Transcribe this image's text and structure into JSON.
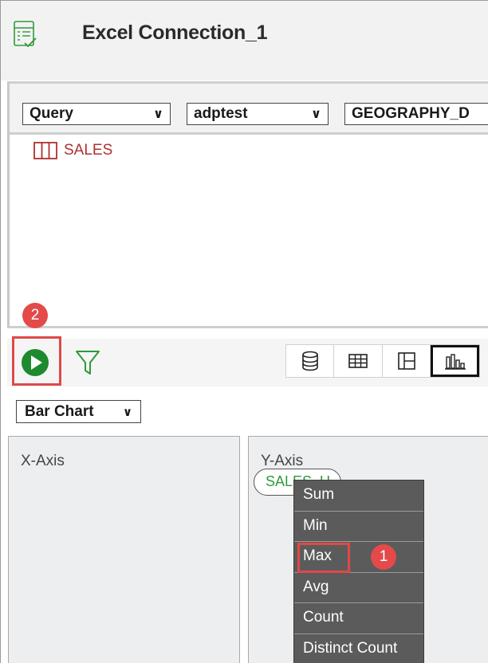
{
  "header": {
    "title": "Excel Connection_1",
    "icon": "excel-connection-icon"
  },
  "query_bar": {
    "query_type": "Query",
    "schema": "adptest",
    "table": "GEOGRAPHY_D"
  },
  "table_list": [
    {
      "label": "SALES",
      "icon": "table-icon"
    }
  ],
  "toolbar": {
    "run_icon": "play-icon",
    "filter_icon": "filter-icon",
    "views": [
      "database-icon",
      "table-view-icon",
      "layout-icon",
      "bar-chart-icon"
    ],
    "active_view": "bar-chart-icon"
  },
  "chart_type": {
    "selected": "Bar Chart"
  },
  "axes": {
    "x_label": "X-Axis",
    "y_label": "Y-Axis",
    "y_field": "SALES_U"
  },
  "aggregation_menu": {
    "items": [
      "Sum",
      "Min",
      "Max",
      "Avg",
      "Count",
      "Distinct Count"
    ],
    "highlighted": "Max"
  },
  "badges": {
    "step1": "1",
    "step2": "2"
  },
  "colors": {
    "highlight": "#e14848",
    "run_green": "#1e8a2e",
    "table_red": "#b03030",
    "menu_bg": "#5b5b5b"
  }
}
